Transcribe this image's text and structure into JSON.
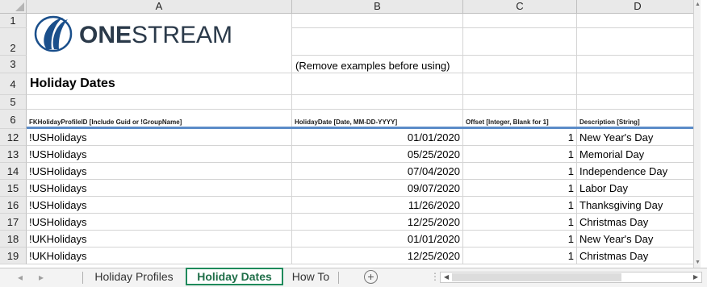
{
  "columns": [
    "A",
    "B",
    "C",
    "D"
  ],
  "logo": {
    "brand_bold": "ONE",
    "brand_rest": "STREAM"
  },
  "title": "Holiday Dates",
  "note": "(Remove examples before using)",
  "header_row": {
    "number": "6",
    "cells": [
      "FKHolidayProfileID [Include Guid or !GroupName]",
      "HolidayDate [Date, MM-DD-YYYY]",
      "Offset [Integer, Blank for 1]",
      "Description [String]"
    ]
  },
  "top_rows": [
    "1",
    "2",
    "3",
    "4",
    "5"
  ],
  "rows": [
    {
      "n": "12",
      "profile": "!USHolidays",
      "date": "01/01/2020",
      "offset": "1",
      "desc": "New Year's Day"
    },
    {
      "n": "13",
      "profile": "!USHolidays",
      "date": "05/25/2020",
      "offset": "1",
      "desc": "Memorial Day"
    },
    {
      "n": "14",
      "profile": "!USHolidays",
      "date": "07/04/2020",
      "offset": "1",
      "desc": "Independence Day"
    },
    {
      "n": "15",
      "profile": "!USHolidays",
      "date": "09/07/2020",
      "offset": "1",
      "desc": "Labor Day"
    },
    {
      "n": "16",
      "profile": "!USHolidays",
      "date": "11/26/2020",
      "offset": "1",
      "desc": "Thanksgiving Day"
    },
    {
      "n": "17",
      "profile": "!USHolidays",
      "date": "12/25/2020",
      "offset": "1",
      "desc": "Christmas Day"
    },
    {
      "n": "18",
      "profile": "!UKHolidays",
      "date": "01/01/2020",
      "offset": "1",
      "desc": "New Year's Day"
    },
    {
      "n": "19",
      "profile": "!UKHolidays",
      "date": "12/25/2020",
      "offset": "1",
      "desc": "Christmas Day"
    }
  ],
  "tabs": {
    "items": [
      "Holiday Profiles",
      "Holiday Dates",
      "How To"
    ],
    "active": "Holiday Dates",
    "add_symbol": "+"
  },
  "colors": {
    "accent": "#1f8a5b",
    "header_rule": "#5b8cc8",
    "logo_blue": "#1a4f8b"
  }
}
